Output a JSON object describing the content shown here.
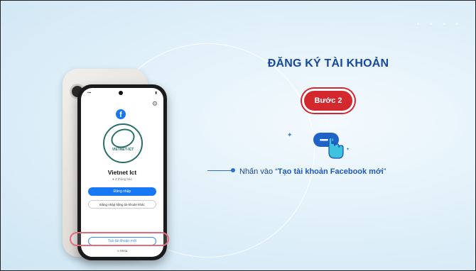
{
  "slide": {
    "title": "ĐĂNG KÝ TÀI KHOẢN",
    "step": "Bước 2",
    "instruction": {
      "prefix": "Nhấn vào ",
      "open_quote": "“",
      "highlight": "Tạo tài khoản Facebook mới",
      "close_quote": "”"
    },
    "decor_dots": "• • • •"
  },
  "phone_screen": {
    "logo": "f",
    "avatar_text": "VIETNET-ICT",
    "profile_name": "Vietnet Ict",
    "profile_sub": "● 2 thông báo",
    "login_button": "Đăng nhập",
    "other_account_button": "Đăng nhập bằng tài khoản khác",
    "create_account_button": "Tạo tài khoản mới",
    "footer": "∞ Meta"
  },
  "colors": {
    "title": "#17479a",
    "step_pill": "#d4282f",
    "facebook_blue": "#1877f2",
    "highlight_ring": "#e36b7c"
  },
  "icons": [
    "facebook-logo-icon",
    "gear-icon",
    "tap-hand-icon"
  ]
}
